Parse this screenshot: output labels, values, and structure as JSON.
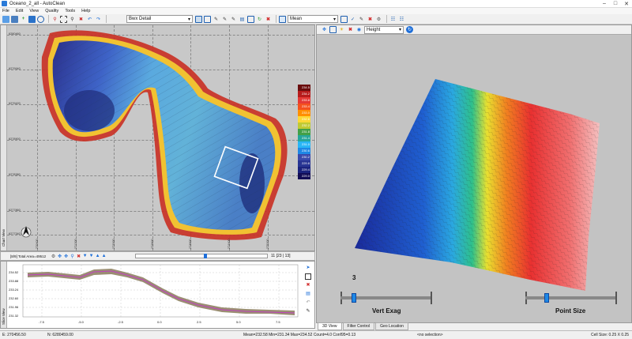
{
  "window": {
    "title": "Oceano_2_all - AutoClean"
  },
  "menu": [
    "File",
    "Edit",
    "View",
    "Quality",
    "Tools",
    "Help"
  ],
  "toolbar": {
    "display_mode": "Bwx Detail",
    "statistic": "Mean"
  },
  "chart_view": {
    "side_label": "Chart View",
    "y_ticks": [
      "6280460",
      "6279940",
      "6279420",
      "6278900",
      "6278380",
      "6277860",
      "6277340"
    ],
    "x_ticks": [
      "270400",
      "271200",
      "272000",
      "272800",
      "273600",
      "274400",
      "275200"
    ],
    "legend": [
      {
        "label": "234.5",
        "color": "#6a0d0d"
      },
      {
        "label": "234.2",
        "color": "#b71c1c"
      },
      {
        "label": "233.8",
        "color": "#e53935"
      },
      {
        "label": "233.4",
        "color": "#f4511e"
      },
      {
        "label": "233.0",
        "color": "#ff8f00"
      },
      {
        "label": "232.6",
        "color": "#fdd835"
      },
      {
        "label": "232.2",
        "color": "#c0ca33"
      },
      {
        "label": "231.8",
        "color": "#43a047"
      },
      {
        "label": "231.4",
        "color": "#26a69a"
      },
      {
        "label": "231.0",
        "color": "#29b6f6"
      },
      {
        "label": "230.6",
        "color": "#1e88e5"
      },
      {
        "label": "230.2",
        "color": "#3949ab"
      },
      {
        "label": "229.8",
        "color": "#283593"
      },
      {
        "label": "229.4",
        "color": "#1a237e"
      },
      {
        "label": "229.0",
        "color": "#120d55"
      }
    ]
  },
  "mid_toolbar": {
    "label": "[8/9] Total Area=49512",
    "pages": "11 [23 | 13]"
  },
  "profile": {
    "side_label": "Slice View",
    "y_ticks": [
      "234.52",
      "233.88",
      "233.24",
      "232.60",
      "231.96",
      "231.32"
    ],
    "x_ticks": [
      "-7.5",
      "-5.0",
      "-2.5",
      "0.0",
      "2.5",
      "5.0",
      "7.5"
    ]
  },
  "view3d": {
    "attribute": "Height",
    "vert_exag_value": "3",
    "vert_exag_label": "Vert Exag",
    "point_size_label": "Point Size",
    "vert_exag": 0.15,
    "point_size": 0.23
  },
  "tabs": [
    "3D View",
    "Filter Control",
    "Geo Location"
  ],
  "status": {
    "e": "E: 270456.50",
    "n": "N: 6280459.00",
    "stats": "Mean=232.58 Min=231.34 Max=234.52 Count=4.0 Conf95=0.13",
    "selection": "<no selection>",
    "cell": "Cell Size: 0.25 X 0.25"
  }
}
